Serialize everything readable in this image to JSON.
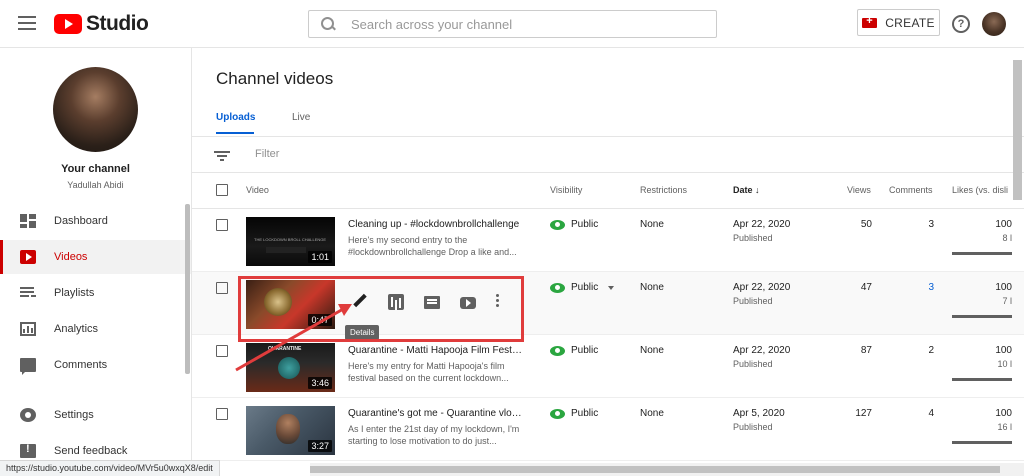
{
  "header": {
    "logo_text": "Studio",
    "search_placeholder": "Search across your channel",
    "create_label": "CREATE",
    "help_symbol": "?",
    "icons": [
      "menu-icon",
      "youtube-logo-icon",
      "search-icon",
      "create-camera-icon",
      "help-icon",
      "account-avatar"
    ]
  },
  "channel": {
    "title": "Your channel",
    "owner": "Yadullah Abidi"
  },
  "sidebar": {
    "items": [
      {
        "label": "Dashboard",
        "icon": "dashboard-icon"
      },
      {
        "label": "Videos",
        "icon": "videos-icon",
        "active": true
      },
      {
        "label": "Playlists",
        "icon": "playlists-icon"
      },
      {
        "label": "Analytics",
        "icon": "analytics-icon"
      },
      {
        "label": "Comments",
        "icon": "comments-icon"
      },
      {
        "label": "Settings",
        "icon": "settings-icon"
      },
      {
        "label": "Send feedback",
        "icon": "feedback-icon"
      }
    ]
  },
  "main": {
    "title": "Channel videos",
    "tabs": [
      {
        "label": "Uploads",
        "active": true
      },
      {
        "label": "Live",
        "active": false
      }
    ],
    "filter_placeholder": "Filter",
    "columns": [
      "Video",
      "Visibility",
      "Restrictions",
      "Date",
      "Views",
      "Comments",
      "Likes (vs. disli"
    ],
    "sort_indicator": "↓",
    "rows": [
      {
        "title": "Cleaning up - #lockdownbrollchallenge",
        "description": "Here's my second entry to the #lockdownbrollchallenge Drop a like and...",
        "duration": "1:01",
        "visibility": "Public",
        "restrictions": "None",
        "date": "Apr 22, 2020",
        "date_status": "Published",
        "views": "50",
        "comments": "3",
        "likes": "100",
        "likes_sub": "8 l"
      },
      {
        "title": "",
        "description": "",
        "duration": "0:47",
        "visibility": "Public",
        "restrictions": "None",
        "date": "Apr 22, 2020",
        "date_status": "Published",
        "views": "47",
        "comments": "3",
        "likes": "100",
        "likes_sub": "7 l"
      },
      {
        "title": "Quarantine - Matti Hapooja Film Festiv...",
        "description": "Here's my entry for Matti Hapooja's film festival based on the current lockdown...",
        "duration": "3:46",
        "visibility": "Public",
        "restrictions": "None",
        "date": "Apr 22, 2020",
        "date_status": "Published",
        "views": "87",
        "comments": "2",
        "likes": "100",
        "likes_sub": "10 l"
      },
      {
        "title": "Quarantine's got me - Quarantine vlog ...",
        "description": "As I enter the 21st day of my lockdown, I'm starting to lose motivation to do just...",
        "duration": "3:27",
        "visibility": "Public",
        "restrictions": "None",
        "date": "Apr 5, 2020",
        "date_status": "Published",
        "views": "127",
        "comments": "4",
        "likes": "100",
        "likes_sub": "16 l"
      }
    ],
    "thumb1_caption": "THE LOCKDOWN BROLL CHALLENGE",
    "thumb3_caption": "QUARANTINE",
    "hover_actions": [
      "details-pencil-icon",
      "analytics-icon",
      "comments-icon",
      "youtube-play-icon",
      "more-options-icon"
    ],
    "tooltip": "Details"
  },
  "status_url": "https://studio.youtube.com/video/MVr5u0wxqX8/edit",
  "colors": {
    "brand_red": "#cc0000",
    "accent_blue": "#065fd4",
    "public_green": "#2ba640",
    "annotation_red": "#e03c3c"
  }
}
